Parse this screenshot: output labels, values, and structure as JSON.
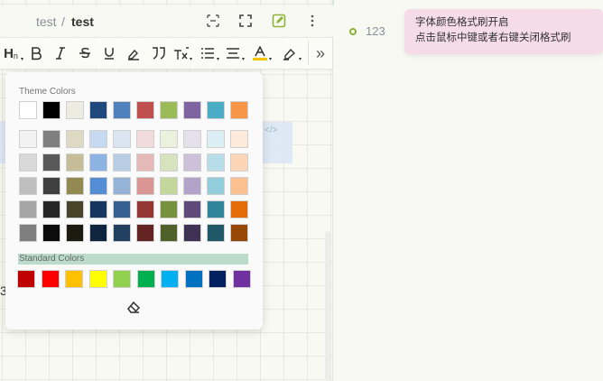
{
  "breadcrumb": {
    "parent": "test",
    "separator": "/",
    "current": "test"
  },
  "header_icons": [
    "code-view-icon",
    "fullscreen-icon",
    "edit-icon",
    "more-icon"
  ],
  "toolbar": {
    "items": [
      "heading-icon",
      "bold-icon",
      "italic-icon",
      "strikethrough-icon",
      "underline-icon",
      "format-brush-icon",
      "quote-icon",
      "superscript-icon",
      "list-icon",
      "align-icon",
      "font-color-icon",
      "highlight-icon"
    ],
    "heading_text": "H",
    "heading_suffix": "n",
    "expand_label": "»"
  },
  "color_popup": {
    "theme_title": "Theme Colors",
    "theme_base": [
      "#ffffff",
      "#000000",
      "#eeece1",
      "#1f497d",
      "#4f81bd",
      "#c0504d",
      "#9bbb59",
      "#8064a2",
      "#4bacc6",
      "#f79646"
    ],
    "theme_shades": [
      [
        "#f2f2f2",
        "#7f7f7f",
        "#ddd9c3",
        "#c6d9f0",
        "#dbe5f1",
        "#f2dcdb",
        "#ebf1dd",
        "#e5e0ec",
        "#dbeef3",
        "#fdeada"
      ],
      [
        "#d8d8d8",
        "#595959",
        "#c4bd97",
        "#8db3e2",
        "#b8cce4",
        "#e5b9b7",
        "#d7e3bc",
        "#ccc1d9",
        "#b7dde8",
        "#fbd5b5"
      ],
      [
        "#bfbfbf",
        "#3f3f3f",
        "#938953",
        "#548dd4",
        "#95b3d7",
        "#d99694",
        "#c3d69b",
        "#b2a2c7",
        "#92cddc",
        "#fac08f"
      ],
      [
        "#a5a5a5",
        "#262626",
        "#494429",
        "#17365d",
        "#366092",
        "#953734",
        "#76923c",
        "#5f497a",
        "#31859b",
        "#e36c09"
      ],
      [
        "#7f7f7f",
        "#0c0c0c",
        "#1d1b10",
        "#0f243e",
        "#244061",
        "#632423",
        "#4f6128",
        "#3f3151",
        "#205867",
        "#974806"
      ]
    ],
    "standard_title": "Standard Colors",
    "standard": [
      "#c00000",
      "#ff0000",
      "#ffc000",
      "#ffff00",
      "#92d050",
      "#00b050",
      "#00b0f0",
      "#0070c0",
      "#002060",
      "#7030a0"
    ],
    "clear_icon": "eraser-icon"
  },
  "editor": {
    "code_hint": "</>",
    "stray_text": "3"
  },
  "outline": {
    "item": "123"
  },
  "tooltip": {
    "line1": "字体颜色格式刷开启",
    "line2": "点击鼠标中键或者右键关闭格式刷"
  }
}
